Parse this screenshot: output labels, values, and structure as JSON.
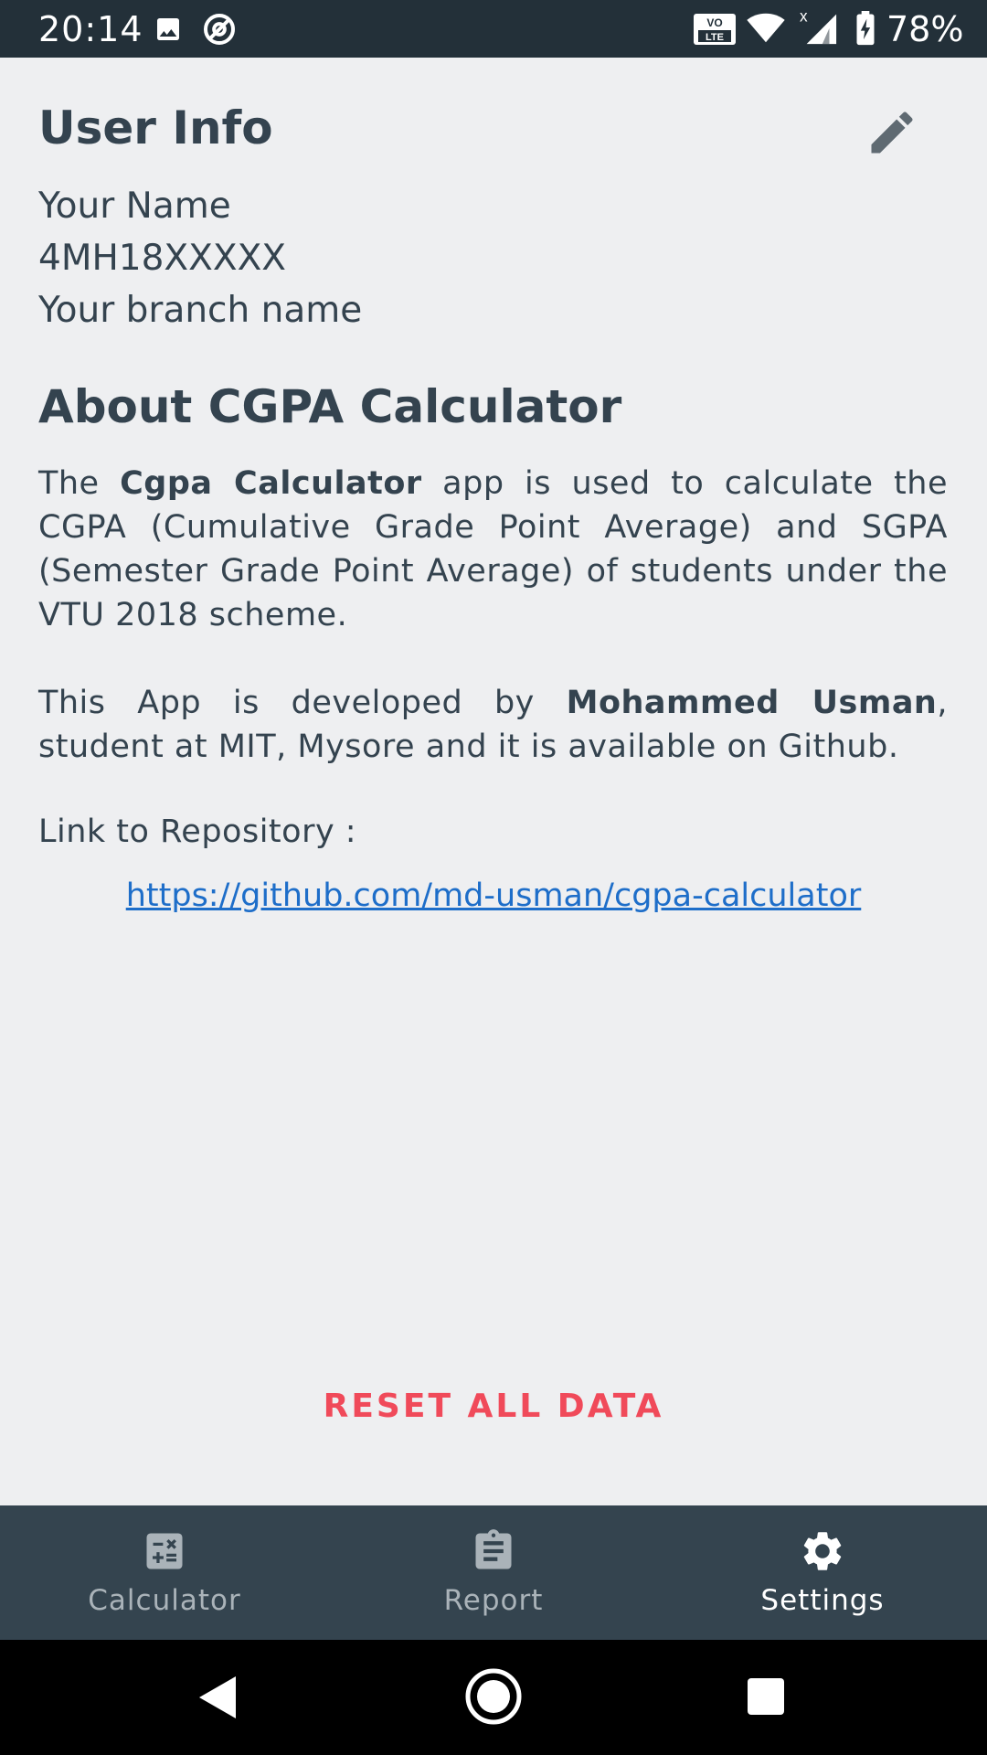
{
  "status_bar": {
    "time": "20:14",
    "battery": "78%",
    "icons": [
      "image-icon",
      "data-saver-icon",
      "volte-icon",
      "wifi-icon",
      "signal-icon",
      "battery-charging-icon"
    ]
  },
  "user_info": {
    "title": "User Info",
    "name": "Your Name",
    "usn": "4MH18XXXXX",
    "branch": "Your branch name"
  },
  "about": {
    "title": "About CGPA Calculator",
    "p1_prefix": "The ",
    "p1_bold": "Cgpa Calculator",
    "p1_suffix": " app is used to calculate the CGPA (Cumulative Grade Point Average) and SGPA (Semester Grade Point Average) of students under the VTU 2018 scheme.",
    "p2_prefix": "This App is developed by ",
    "p2_bold": "Mohammed Usman",
    "p2_suffix": ", student at MIT, Mysore and it is available on Github.",
    "link_label": "Link to Repository :",
    "link_url": "https://github.com/md-usman/cgpa-calculator"
  },
  "reset_label": "RESET ALL DATA",
  "bottom_nav": {
    "items": [
      {
        "label": "Calculator",
        "icon": "calculator-icon"
      },
      {
        "label": "Report",
        "icon": "clipboard-icon"
      },
      {
        "label": "Settings",
        "icon": "gear-icon",
        "active": true
      }
    ]
  },
  "colors": {
    "status_bar": "#233039",
    "background": "#eeeff1",
    "text": "#34434f",
    "link": "#1e6ec9",
    "reset": "#f04a5a",
    "bottom_nav": "#34444f"
  }
}
